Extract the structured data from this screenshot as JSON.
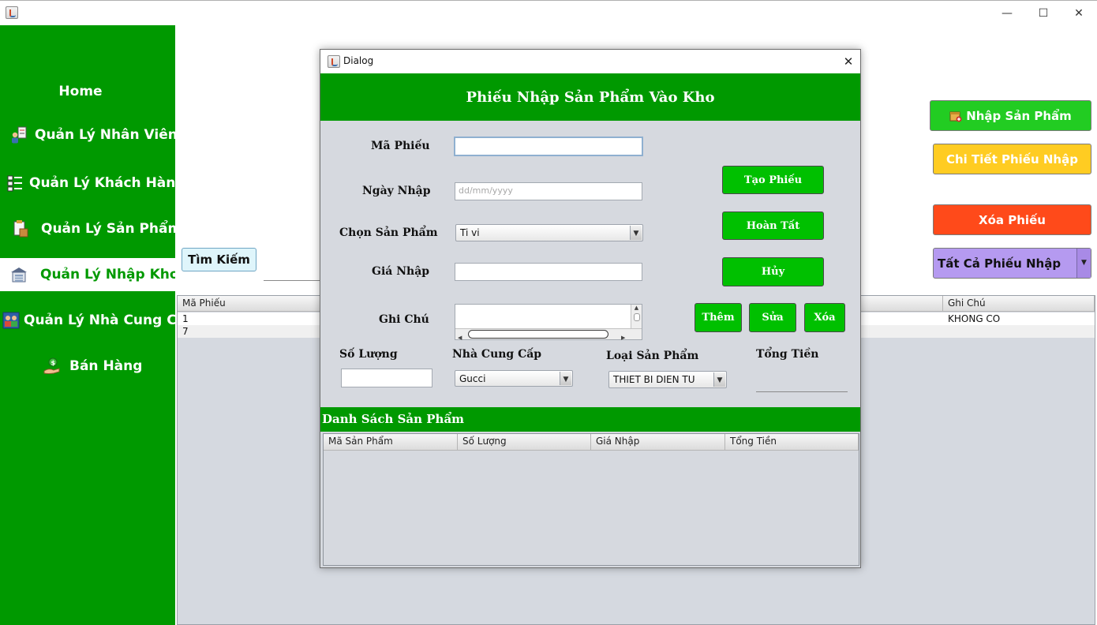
{
  "window": {
    "controls": {
      "minimize": "—",
      "maximize": "☐",
      "close": "✕"
    }
  },
  "sidebar": {
    "items": [
      {
        "label": "Home",
        "icon": "home",
        "active": false
      },
      {
        "label": "Quản Lý Nhân Viên",
        "icon": "employee-icon",
        "active": false
      },
      {
        "label": "Quản Lý Khách Hàng",
        "icon": "customer-list-icon",
        "active": false
      },
      {
        "label": "Quản Lý Sản Phẩm",
        "icon": "product-box-icon",
        "active": false
      },
      {
        "label": "Quản Lý Nhập Kho",
        "icon": "warehouse-icon",
        "active": true
      },
      {
        "label": "Quản Lý Nhà Cung Cấp",
        "icon": "supplier-icon",
        "active": false
      },
      {
        "label": "Bán Hàng",
        "icon": "sales-icon",
        "active": false
      }
    ]
  },
  "actions": {
    "import_product": "Nhập Sản Phẩm",
    "receipt_detail": "Chi Tiết Phiếu Nhập",
    "delete_receipt": "Xóa Phiếu",
    "filter_selected": "Tất Cả Phiếu Nhập"
  },
  "colors": {
    "sidebar": "#009900",
    "import_button": "#22cc22",
    "detail_button": "#ffcc22",
    "delete_button": "#ff4a1a",
    "filter_combo": "#b59af0"
  },
  "search": {
    "label": "Tìm Kiếm"
  },
  "main_table": {
    "columns": [
      "Mã Phiếu",
      "Ghi Chú"
    ],
    "rows": [
      {
        "id": "1",
        "note": "KHONG CO"
      },
      {
        "id": "7",
        "note": ""
      }
    ]
  },
  "dialog": {
    "title": "Dialog",
    "header": "Phiếu Nhập Sản Phẩm Vào Kho",
    "labels": {
      "receipt_id": "Mã Phiếu",
      "import_date": "Ngày Nhập",
      "choose_product": "Chọn Sản Phẩm",
      "import_price": "Giá Nhập",
      "note": "Ghi Chú",
      "quantity": "Số Lượng",
      "supplier": "Nhà Cung Cấp",
      "product_type": "Loại Sản Phẩm",
      "total": "Tổng Tiền"
    },
    "fields": {
      "receipt_id": "",
      "import_date_placeholder": "dd/mm/yyyy",
      "product": "Ti vi",
      "import_price": "",
      "note": "",
      "quantity": "",
      "supplier": "Gucci",
      "product_type": "THIET BI DIEN TU"
    },
    "buttons": {
      "create": "Tạo Phiếu",
      "complete": "Hoàn Tất",
      "cancel": "Hủy",
      "add": "Thêm",
      "edit": "Sửa",
      "delete": "Xóa"
    },
    "list": {
      "title": "Danh Sách Sản Phẩm",
      "columns": [
        "Mã Sản Phẩm",
        "Số Lượng",
        "Giá Nhập",
        "Tổng Tiền"
      ]
    }
  }
}
